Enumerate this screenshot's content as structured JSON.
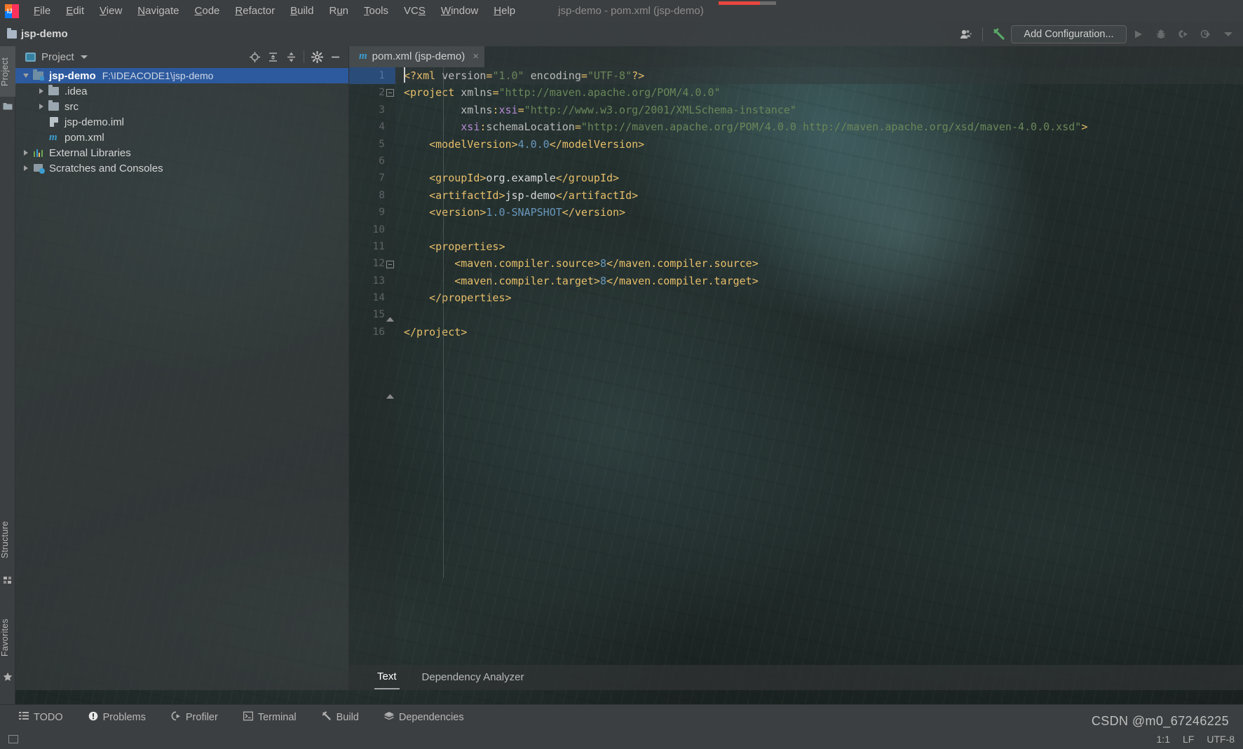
{
  "window": {
    "title": "jsp-demo - pom.xml (jsp-demo)",
    "logo_name": "intellij-idea-logo"
  },
  "menubar": {
    "items": [
      {
        "label": "File",
        "mnemonic": "F"
      },
      {
        "label": "Edit",
        "mnemonic": "E"
      },
      {
        "label": "View",
        "mnemonic": "V"
      },
      {
        "label": "Navigate",
        "mnemonic": "N"
      },
      {
        "label": "Code",
        "mnemonic": "C"
      },
      {
        "label": "Refactor",
        "mnemonic": "R"
      },
      {
        "label": "Build",
        "mnemonic": "B"
      },
      {
        "label": "Run",
        "mnemonic": "u"
      },
      {
        "label": "Tools",
        "mnemonic": "T"
      },
      {
        "label": "VCS",
        "mnemonic": "S"
      },
      {
        "label": "Window",
        "mnemonic": "W"
      },
      {
        "label": "Help",
        "mnemonic": "H"
      }
    ]
  },
  "navbar": {
    "breadcrumb": "jsp-demo",
    "add_configuration_label": "Add Configuration...",
    "icons": {
      "account": "user-account-icon",
      "account_caret": "chevron-down-icon",
      "build": "build-hammer-icon",
      "run": "run-icon",
      "debug": "debug-bug-icon",
      "coverage": "run-with-coverage-icon",
      "profile": "profile-icon",
      "more": "chevron-down-icon"
    }
  },
  "left_strip": {
    "items": [
      {
        "label": "Project",
        "icon": "project-folder-icon",
        "selected": true
      },
      {
        "label": "Structure",
        "icon": "structure-icon",
        "selected": false
      },
      {
        "label": "Favorites",
        "icon": "favorites-star-icon",
        "selected": false
      }
    ]
  },
  "project_panel": {
    "title": "Project",
    "title_icon": "project-view-icon",
    "actions": [
      {
        "name": "scroll-from-source-icon",
        "glyph": "target"
      },
      {
        "name": "collapse-all-icon",
        "glyph": "collapse"
      },
      {
        "name": "expand-all-icon",
        "glyph": "expand"
      },
      {
        "name": "settings-gear-icon",
        "glyph": "gear"
      },
      {
        "name": "hide-panel-icon",
        "glyph": "minus"
      }
    ],
    "tree": [
      {
        "label": "jsp-demo",
        "path": "F:\\IDEACODE1\\jsp-demo",
        "icon": "module-folder-icon",
        "indent": 0,
        "expanded": true,
        "selected": true,
        "bold": true
      },
      {
        "label": ".idea",
        "path": "",
        "icon": "folder-icon",
        "indent": 1,
        "expanded": false,
        "selected": false,
        "bold": false
      },
      {
        "label": "src",
        "path": "",
        "icon": "folder-icon",
        "indent": 1,
        "expanded": false,
        "selected": false,
        "bold": false
      },
      {
        "label": "jsp-demo.iml",
        "path": "",
        "icon": "iml-file-icon",
        "indent": 1,
        "expanded": null,
        "selected": false,
        "bold": false
      },
      {
        "label": "pom.xml",
        "path": "",
        "icon": "maven-pom-icon",
        "indent": 1,
        "expanded": null,
        "selected": false,
        "bold": false
      },
      {
        "label": "External Libraries",
        "path": "",
        "icon": "external-libraries-icon",
        "indent": 0,
        "expanded": false,
        "selected": false,
        "bold": false
      },
      {
        "label": "Scratches and Consoles",
        "path": "",
        "icon": "scratches-icon",
        "indent": 0,
        "expanded": false,
        "selected": false,
        "bold": false
      }
    ]
  },
  "editor": {
    "tab": {
      "label": "pom.xml (jsp-demo)",
      "icon": "maven-pom-icon",
      "close": "×"
    },
    "bottom_tabs": [
      {
        "label": "Text",
        "selected": true
      },
      {
        "label": "Dependency Analyzer",
        "selected": false
      }
    ],
    "line_numbers": [
      "1",
      "2",
      "3",
      "4",
      "5",
      "6",
      "7",
      "8",
      "9",
      "10",
      "11",
      "12",
      "13",
      "14",
      "15",
      "16"
    ],
    "code_lines": [
      "<?xml version=\"1.0\" encoding=\"UTF-8\"?>",
      "<project xmlns=\"http://maven.apache.org/POM/4.0.0\"",
      "         xmlns:xsi=\"http://www.w3.org/2001/XMLSchema-instance\"",
      "         xsi:schemaLocation=\"http://maven.apache.org/POM/4.0.0 http://maven.apache.org/xsd/maven-4.0.0.xsd\">",
      "    <modelVersion>4.0.0</modelVersion>",
      "",
      "    <groupId>org.example</groupId>",
      "    <artifactId>jsp-demo</artifactId>",
      "    <version>1.0-SNAPSHOT</version>",
      "",
      "    <properties>",
      "        <maven.compiler.source>8</maven.compiler.source>",
      "        <maven.compiler.target>8</maven.compiler.target>",
      "    </properties>",
      "",
      "</project>"
    ]
  },
  "bottom_bar": {
    "items": [
      {
        "label": "TODO",
        "icon": "todo-list-icon"
      },
      {
        "label": "Problems",
        "icon": "problems-warning-icon"
      },
      {
        "label": "Profiler",
        "icon": "profiler-icon"
      },
      {
        "label": "Terminal",
        "icon": "terminal-icon"
      },
      {
        "label": "Build",
        "icon": "build-hammer-icon"
      },
      {
        "label": "Dependencies",
        "icon": "dependencies-stack-icon"
      }
    ]
  },
  "status_bar": {
    "caret_position": "1:1",
    "line_separator": "LF",
    "encoding": "UTF-8"
  },
  "watermark": {
    "text": "CSDN @m0_67246225"
  },
  "colors": {
    "accent_selection": "#2d5a9e",
    "tag": "#e8bf6a",
    "string": "#6a8759",
    "namespace": "#b589d6",
    "number": "#6897bb",
    "panel_bg": "#3c3f41",
    "progress_red": "#e8473f"
  }
}
